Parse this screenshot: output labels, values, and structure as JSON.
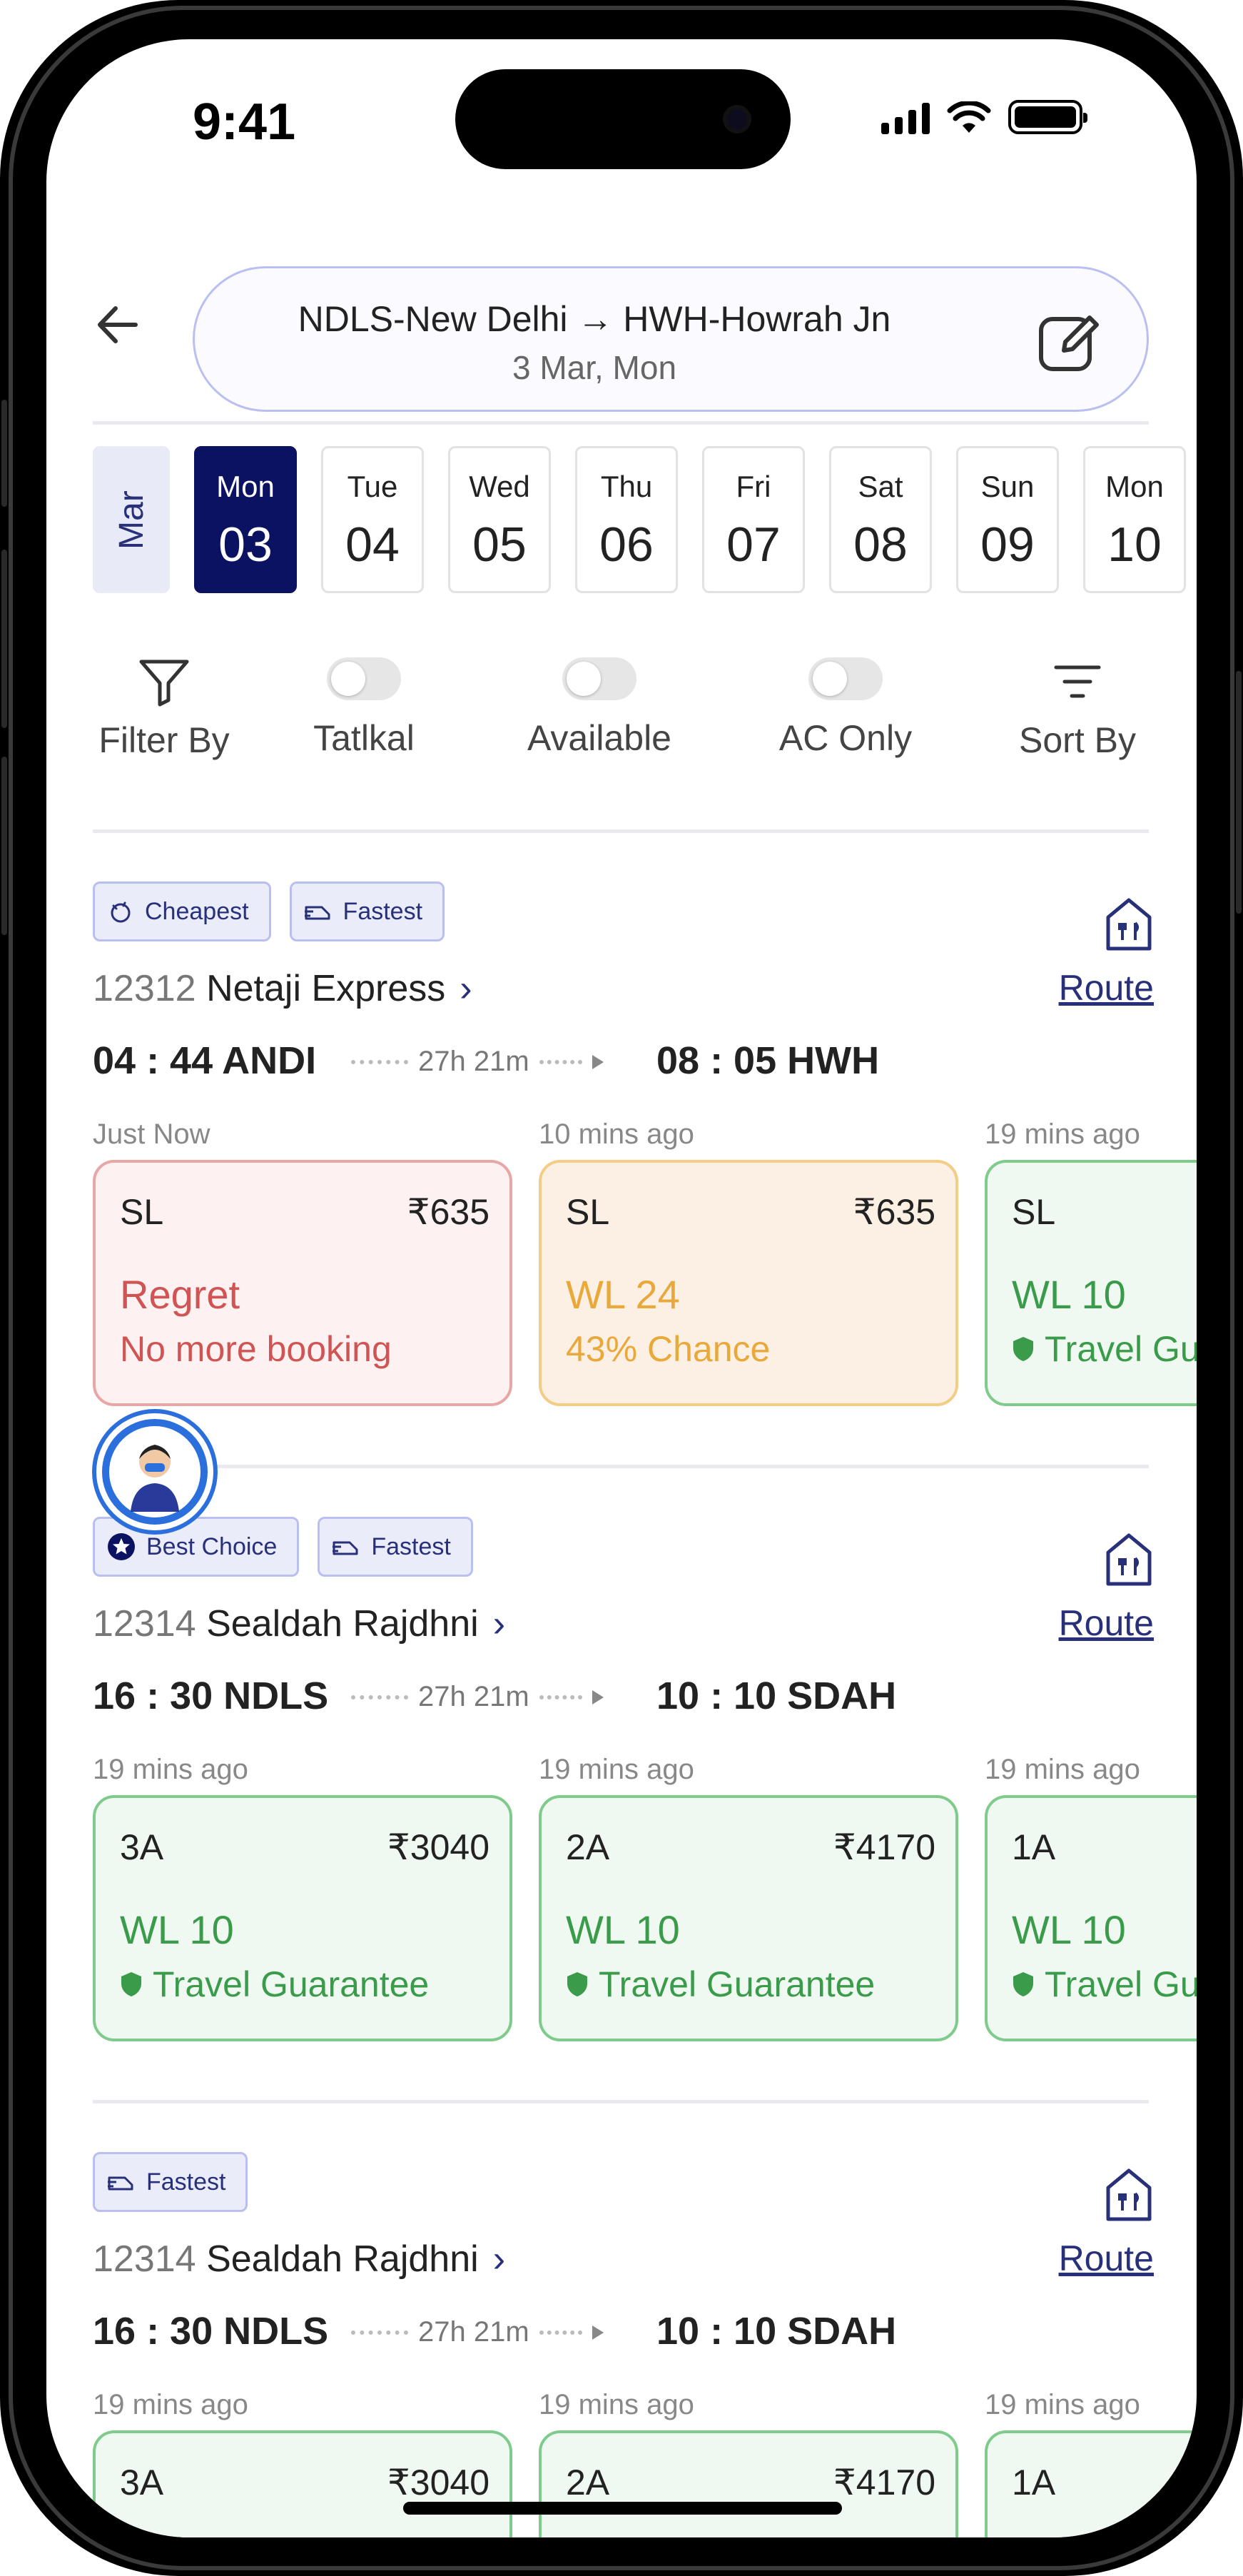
{
  "status_bar": {
    "time": "9:41"
  },
  "header": {
    "route": "NDLS-New Delhi → HWH-Howrah Jn",
    "date": "3 Mar, Mon"
  },
  "date_strip": {
    "month": "Mar",
    "days": [
      {
        "name": "Mon",
        "date": "03",
        "selected": true
      },
      {
        "name": "Tue",
        "date": "04"
      },
      {
        "name": "Wed",
        "date": "05"
      },
      {
        "name": "Thu",
        "date": "06"
      },
      {
        "name": "Fri",
        "date": "07"
      },
      {
        "name": "Sat",
        "date": "08"
      },
      {
        "name": "Sun",
        "date": "09"
      },
      {
        "name": "Mon",
        "date": "10"
      }
    ]
  },
  "filters": {
    "filter_by": "Filter By",
    "tatkal": "Tatlkal",
    "available": "Available",
    "ac_only": "AC Only",
    "sort_by": "Sort By"
  },
  "route_label": "Route",
  "trains": [
    {
      "tags": [
        "Cheapest",
        "Fastest"
      ],
      "number": "12312",
      "name": "Netaji Express",
      "dep": "04 : 44 ANDI",
      "duration": "27h 21m",
      "arr": "08 : 05 HWH",
      "classes": [
        {
          "ago": "Just Now",
          "cls": "SL",
          "price": "₹635",
          "status": "Regret",
          "sub": "No more booking",
          "tone": "red"
        },
        {
          "ago": "10 mins ago",
          "cls": "SL",
          "price": "₹635",
          "status": "WL 24",
          "sub": "43% Chance",
          "tone": "orange"
        },
        {
          "ago": "19 mins ago",
          "cls": "SL",
          "price": "",
          "status": "WL 10",
          "sub": "Travel Guarantee",
          "tone": "green"
        }
      ]
    },
    {
      "tags": [
        "Best Choice",
        "Fastest"
      ],
      "number": "12314",
      "name": "Sealdah Rajdhni",
      "dep": "16 : 30 NDLS",
      "duration": "27h 21m",
      "arr": "10 : 10 SDAH",
      "classes": [
        {
          "ago": "19 mins ago",
          "cls": "3A",
          "price": "₹3040",
          "status": "WL 10",
          "sub": "Travel Guarantee",
          "tone": "green"
        },
        {
          "ago": "19 mins ago",
          "cls": "2A",
          "price": "₹4170",
          "status": "WL 10",
          "sub": "Travel Guarantee",
          "tone": "green"
        },
        {
          "ago": "19 mins ago",
          "cls": "1A",
          "price": "",
          "status": "WL 10",
          "sub": "Travel Guarantee",
          "tone": "green"
        }
      ]
    },
    {
      "tags": [
        "Fastest"
      ],
      "number": "12314",
      "name": "Sealdah Rajdhni",
      "dep": "16 : 30 NDLS",
      "duration": "27h 21m",
      "arr": "10 : 10 SDAH",
      "classes": [
        {
          "ago": "19 mins ago",
          "cls": "3A",
          "price": "₹3040",
          "status": "",
          "sub": "",
          "tone": "green"
        },
        {
          "ago": "19 mins ago",
          "cls": "2A",
          "price": "₹4170",
          "status": "",
          "sub": "",
          "tone": "green"
        },
        {
          "ago": "19 mins ago",
          "cls": "1A",
          "price": "",
          "status": "",
          "sub": "",
          "tone": "green"
        }
      ]
    }
  ],
  "colors": {
    "primary": "#0b1262",
    "accent": "#28307a",
    "available": "#3a9b4a",
    "regret": "#d05454",
    "waitlist": "#e9a93a"
  }
}
